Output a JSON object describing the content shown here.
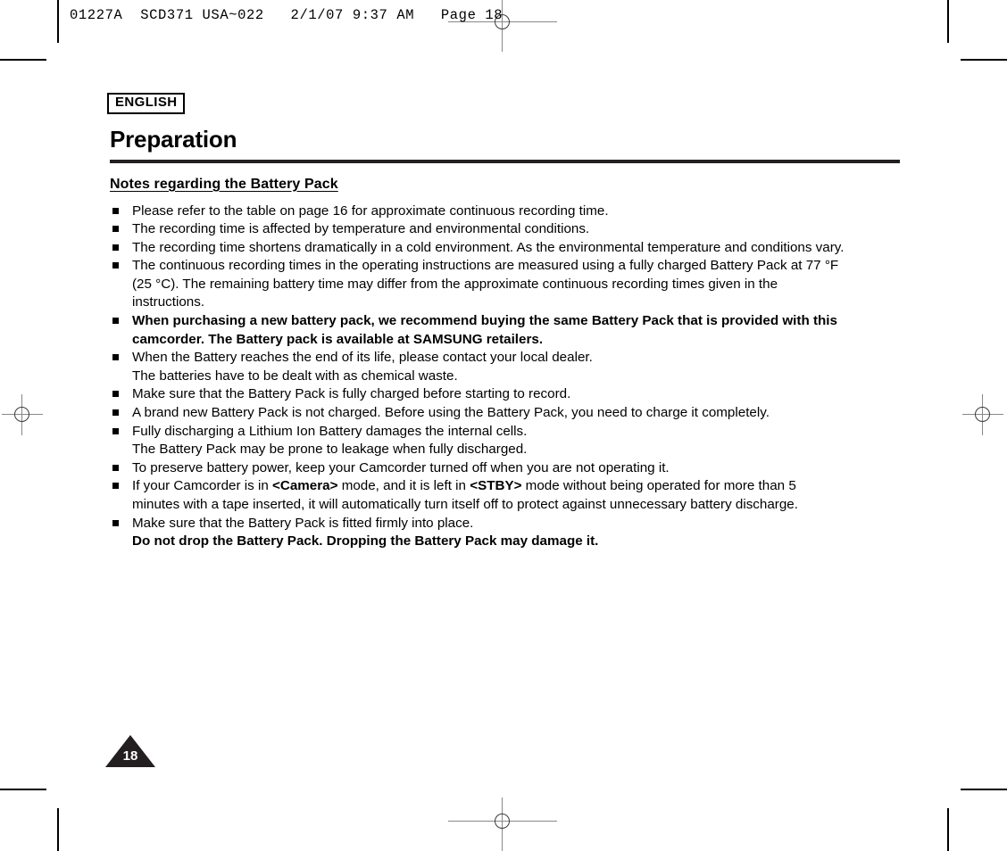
{
  "print_header": "01227A  SCD371 USA~022   2/1/07 9:37 AM   Page 18",
  "language_badge": "ENGLISH",
  "page_title": "Preparation",
  "section_heading": "Notes regarding the Battery Pack",
  "page_number": "18",
  "colors": {
    "rule": "#231f20",
    "text": "#000000",
    "page_badge": "#231f20"
  },
  "notes": [
    {
      "bold": false,
      "lines": [
        {
          "runs": [
            {
              "t": "Please refer to the table on page 16 for approximate continuous recording time.",
              "b": false
            }
          ]
        }
      ]
    },
    {
      "bold": false,
      "lines": [
        {
          "runs": [
            {
              "t": "The recording time is affected by temperature and environmental conditions.",
              "b": false
            }
          ]
        }
      ]
    },
    {
      "bold": false,
      "lines": [
        {
          "runs": [
            {
              "t": "The recording time shortens dramatically in a cold environment. As the environmental temperature and conditions vary.",
              "b": false
            }
          ]
        }
      ]
    },
    {
      "bold": false,
      "lines": [
        {
          "runs": [
            {
              "t": "The continuous recording times in the operating instructions are measured using a fully charged Battery Pack at 77 °F",
              "b": false
            }
          ]
        },
        {
          "runs": [
            {
              "t": "(25 °C). The remaining battery time may differ from the approximate continuous recording times given in the",
              "b": false
            }
          ]
        },
        {
          "runs": [
            {
              "t": "instructions.",
              "b": false
            }
          ]
        }
      ]
    },
    {
      "bold": true,
      "lines": [
        {
          "runs": [
            {
              "t": "When purchasing a new battery pack, we recommend buying the same Battery Pack that is provided with this",
              "b": true
            }
          ]
        },
        {
          "runs": [
            {
              "t": "camcorder. The Battery pack is available at SAMSUNG retailers.",
              "b": true
            }
          ]
        }
      ]
    },
    {
      "bold": false,
      "lines": [
        {
          "runs": [
            {
              "t": "When the Battery reaches the end of its life, please contact your local dealer.",
              "b": false
            }
          ]
        },
        {
          "runs": [
            {
              "t": "The batteries have to be dealt with as chemical waste.",
              "b": false
            }
          ]
        }
      ]
    },
    {
      "bold": false,
      "lines": [
        {
          "runs": [
            {
              "t": "Make sure that the Battery Pack is fully charged before starting to record.",
              "b": false
            }
          ]
        }
      ]
    },
    {
      "bold": false,
      "lines": [
        {
          "runs": [
            {
              "t": "A brand new Battery Pack is not charged. Before using the Battery Pack, you need to charge it completely.",
              "b": false
            }
          ]
        }
      ]
    },
    {
      "bold": false,
      "lines": [
        {
          "runs": [
            {
              "t": "Fully discharging a Lithium Ion Battery damages the internal cells.",
              "b": false
            }
          ]
        },
        {
          "runs": [
            {
              "t": "The Battery Pack may be prone to leakage when fully discharged.",
              "b": false
            }
          ]
        }
      ]
    },
    {
      "bold": false,
      "lines": [
        {
          "runs": [
            {
              "t": "To preserve battery power, keep your Camcorder turned off when you are not operating it.",
              "b": false
            }
          ]
        }
      ]
    },
    {
      "bold": false,
      "lines": [
        {
          "runs": [
            {
              "t": "If your Camcorder is in ",
              "b": false
            },
            {
              "t": "<Camera>",
              "b": true
            },
            {
              "t": " mode, and it is left in ",
              "b": false
            },
            {
              "t": "<STBY>",
              "b": true
            },
            {
              "t": " mode without being operated for more than 5",
              "b": false
            }
          ]
        },
        {
          "runs": [
            {
              "t": "minutes with a tape inserted, it will automatically turn itself off to protect against unnecessary battery discharge.",
              "b": false
            }
          ]
        }
      ]
    },
    {
      "bold": false,
      "lines": [
        {
          "runs": [
            {
              "t": "Make sure that the Battery Pack is fitted firmly into place.",
              "b": false
            }
          ]
        },
        {
          "runs": [
            {
              "t": "Do not drop the Battery Pack. Dropping the Battery Pack may damage it.",
              "b": true
            }
          ]
        }
      ]
    }
  ]
}
